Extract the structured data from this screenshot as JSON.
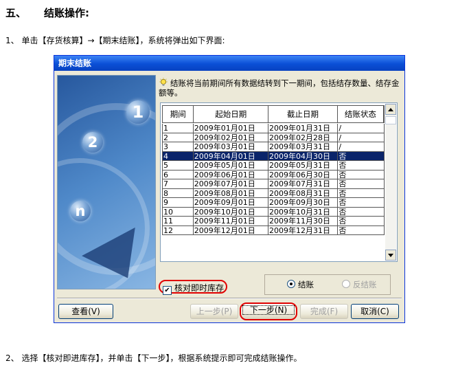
{
  "doc": {
    "heading_number": "五、",
    "heading_text": "结账操作:",
    "step1": "1、 单击【存货核算】→【期末结账】，系统将弹出如下界面:",
    "step2": "2、 选择【核对即进库存】，并单击【下一步】，根据系统提示即可完成结账操作。"
  },
  "dialog": {
    "title": "期末结账",
    "hint": "结账将当前期间所有数据结转到下一期间，包括结存数量、结存金额等。",
    "panel_digits": [
      "1",
      "2",
      "n"
    ],
    "table": {
      "columns": [
        "期间",
        "起始日期",
        "截止日期",
        "结账状态"
      ],
      "selected_row_index": 3,
      "rows": [
        [
          "1",
          "2009年01月01日",
          "2009年01月31日",
          "/"
        ],
        [
          "2",
          "2009年02月01日",
          "2009年02月28日",
          "/"
        ],
        [
          "3",
          "2009年03月01日",
          "2009年03月31日",
          "/"
        ],
        [
          "4",
          "2009年04月01日",
          "2009年04月30日",
          "否"
        ],
        [
          "5",
          "2009年05月01日",
          "2009年05月31日",
          "否"
        ],
        [
          "6",
          "2009年06月01日",
          "2009年06月30日",
          "否"
        ],
        [
          "7",
          "2009年07月01日",
          "2009年07月31日",
          "否"
        ],
        [
          "8",
          "2009年08月01日",
          "2009年08月31日",
          "否"
        ],
        [
          "9",
          "2009年09月01日",
          "2009年09月30日",
          "否"
        ],
        [
          "10",
          "2009年10月01日",
          "2009年10月31日",
          "否"
        ],
        [
          "11",
          "2009年11月01日",
          "2009年11月30日",
          "否"
        ],
        [
          "12",
          "2009年12月01日",
          "2009年12月31日",
          "否"
        ]
      ]
    },
    "checkbox": {
      "label": "核对即时库存",
      "checked": true,
      "mark": "✔"
    },
    "radios": [
      {
        "label": "结账",
        "selected": true,
        "enabled": true
      },
      {
        "label": "反结账",
        "selected": false,
        "enabled": false
      }
    ],
    "buttons": {
      "view": "查看(V)",
      "prev": "上一步(P)",
      "next": "下一步(N)",
      "finish": "完成(F)",
      "cancel": "取消(C)"
    }
  },
  "colors": {
    "titlebar": "#0a4fd6",
    "selection": "#0a246a",
    "annotation": "#e00000",
    "dialog_bg": "#ece9d8"
  }
}
